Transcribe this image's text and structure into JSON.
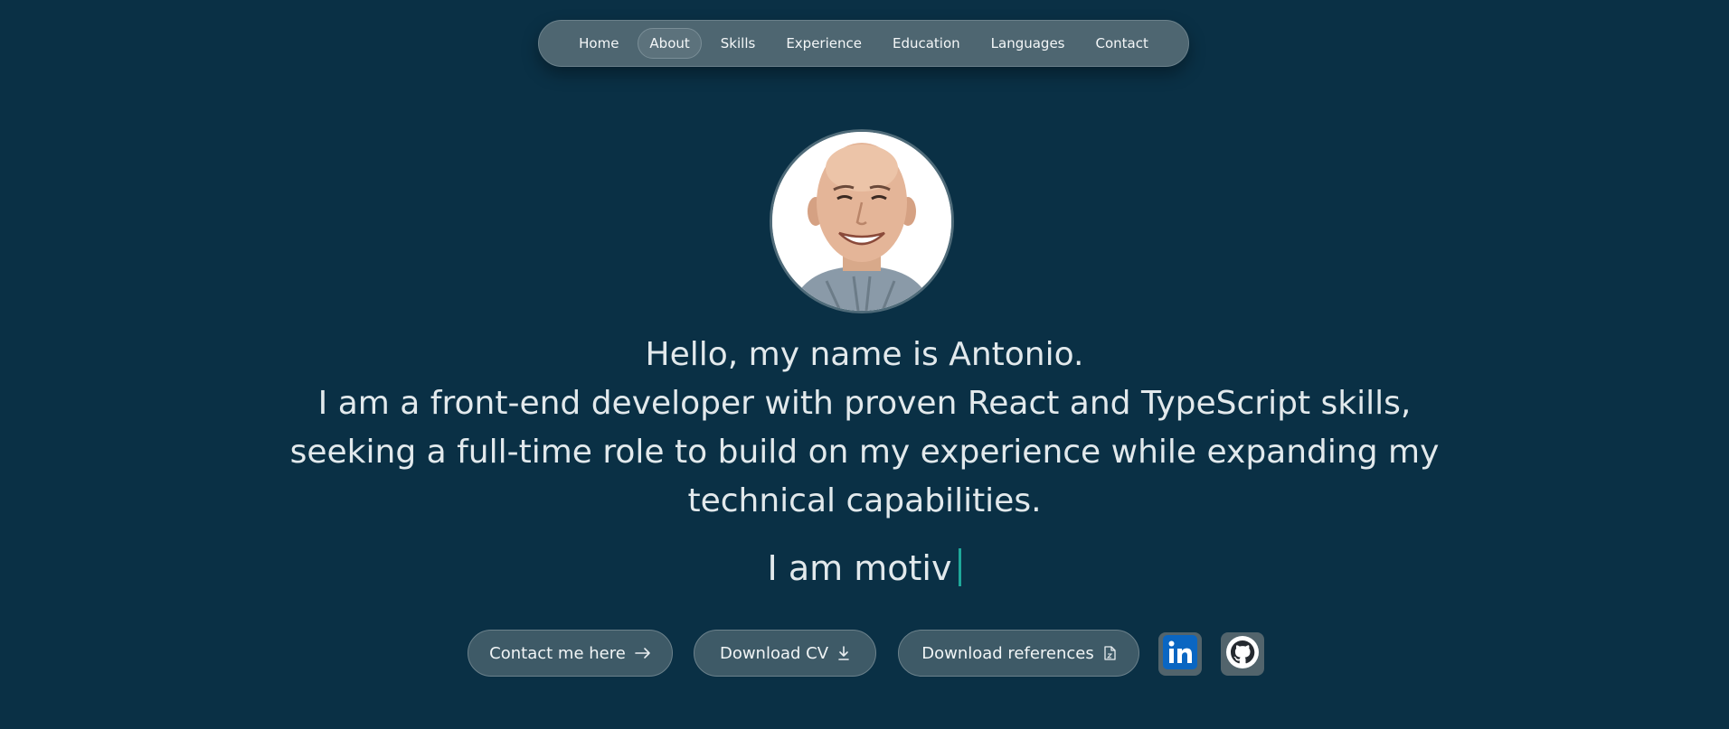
{
  "nav": {
    "items": [
      {
        "label": "Home"
      },
      {
        "label": "About"
      },
      {
        "label": "Skills"
      },
      {
        "label": "Experience"
      },
      {
        "label": "Education"
      },
      {
        "label": "Languages"
      },
      {
        "label": "Contact"
      }
    ],
    "active": "About"
  },
  "hero": {
    "greeting": "Hello, my name is Antonio.",
    "intro_line1": "I am a front-end developer with proven React and TypeScript skills,",
    "intro_line2": "seeking a full-time role to build on my experience while expanding my",
    "intro_line3": "technical capabilities.",
    "typing_text": "I am motiv"
  },
  "actions": {
    "contact_label": "Contact me here",
    "cv_label": "Download CV",
    "references_label": "Download references"
  },
  "icons": {
    "contact": "arrow-right-icon",
    "cv": "download-icon",
    "references": "zip-file-icon",
    "linkedin": "linkedin-icon",
    "github": "github-icon"
  },
  "colors": {
    "background": "#0a3045",
    "accent": "#1fa89a",
    "linkedin": "#0a66c2"
  }
}
